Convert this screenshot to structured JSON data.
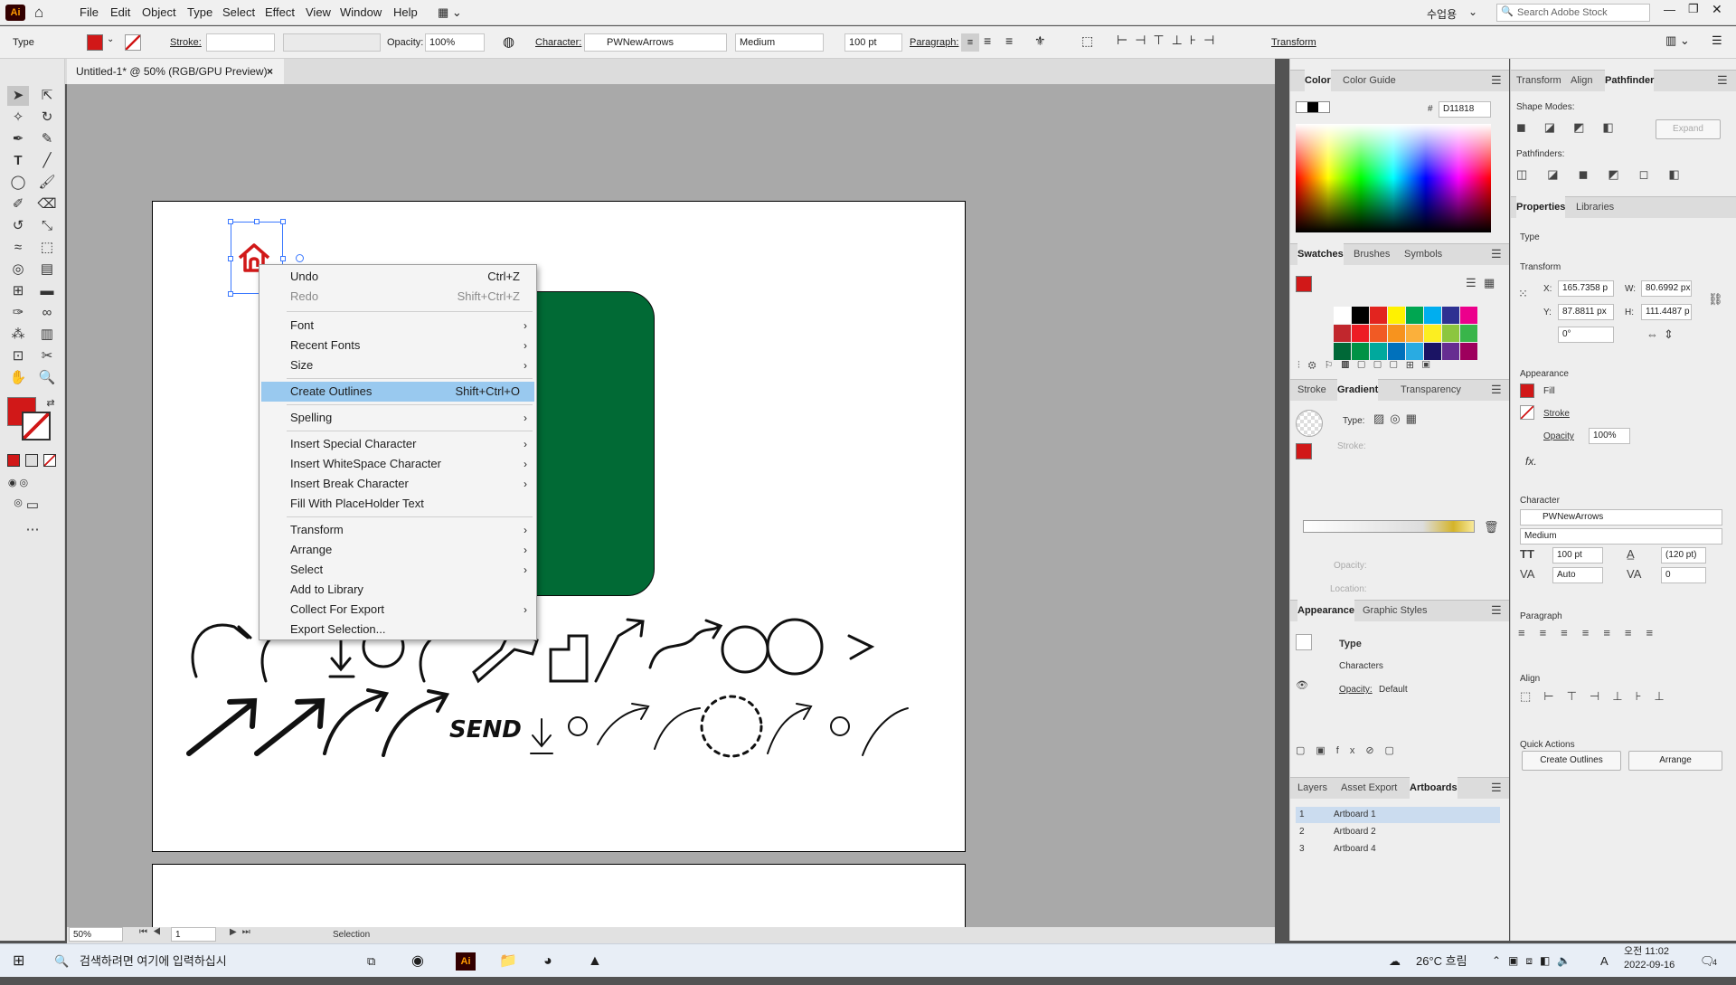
{
  "app": {
    "logo": "Ai",
    "ws": "수업용",
    "stock": "Search Adobe Stock"
  },
  "menu": [
    "File",
    "Edit",
    "Object",
    "Type",
    "Select",
    "Effect",
    "View",
    "Window",
    "Help"
  ],
  "ctrl": {
    "type": "Type",
    "stroke": "Stroke:",
    "opacity_l": "Opacity:",
    "opacity": "100%",
    "char_l": "Character:",
    "font": "PWNewArrows",
    "style": "Medium",
    "size": "100 pt",
    "para_l": "Paragraph:",
    "transform": "Transform"
  },
  "doc": {
    "tab": "Untitled-1* @ 50% (RGB/GPU Preview)",
    "close": "×"
  },
  "ctx": {
    "undo": "Undo",
    "undo_k": "Ctrl+Z",
    "redo": "Redo",
    "redo_k": "Shift+Ctrl+Z",
    "font": "Font",
    "recent": "Recent Fonts",
    "size": "Size",
    "outlines": "Create Outlines",
    "outlines_k": "Shift+Ctrl+O",
    "spell": "Spelling",
    "special": "Insert Special Character",
    "ws": "Insert WhiteSpace Character",
    "brk": "Insert Break Character",
    "fill": "Fill With PlaceHolder Text",
    "transform": "Transform",
    "arrange": "Arrange",
    "select": "Select",
    "lib": "Add to Library",
    "collect": "Collect For Export",
    "export": "Export Selection...",
    "arrow": "›"
  },
  "art": {
    "send": "SEND"
  },
  "color": {
    "tab1": "Color",
    "tab2": "Color Guide",
    "hex": "D11818",
    "hash": "#"
  },
  "sw": {
    "tab1": "Swatches",
    "tab2": "Brushes",
    "tab3": "Symbols",
    "row1": [
      "#ffffff",
      "#000000",
      "#e2241f",
      "#fff200",
      "#00a651",
      "#00aeef",
      "#2e3192",
      "#ec008c"
    ],
    "row2": [
      "#c1272d",
      "#ed1c24",
      "#f15a24",
      "#f7931e",
      "#fbb03b",
      "#fcee21",
      "#8cc63f",
      "#39b54a"
    ],
    "row3": [
      "#006837",
      "#009245",
      "#00a99d",
      "#0071bc",
      "#29abe2",
      "#1b1464",
      "#662d91",
      "#9e005d"
    ]
  },
  "grad": {
    "tab1": "Stroke",
    "tab2": "Gradient",
    "tab3": "Transparency",
    "type": "Type:",
    "stroke": "Stroke:",
    "opacity": "Opacity:",
    "location": "Location:"
  },
  "appear": {
    "tab1": "Appearance",
    "tab2": "Graphic Styles",
    "type": "Type",
    "chars": "Characters",
    "op": "Opacity:",
    "def": "Default"
  },
  "layers": {
    "tab1": "Layers",
    "tab2": "Asset Export",
    "tab3": "Artboards",
    "rows": [
      {
        "n": "1",
        "name": "Artboard 1"
      },
      {
        "n": "2",
        "name": "Artboard 2"
      },
      {
        "n": "3",
        "name": "Artboard 4"
      }
    ]
  },
  "rp2": {
    "tab1": "Transform",
    "tab2": "Align",
    "tab3": "Pathfinder",
    "shape": "Shape Modes:",
    "pf": "Pathfinders:",
    "expand": "Expand",
    "ptab1": "Properties",
    "ptab2": "Libraries",
    "type": "Type",
    "tr": "Transform",
    "x": "165.7358 p",
    "y": "87.8811 px",
    "w": "80.6992 px",
    "h": "111.4487 p",
    "ang": "0°",
    "ap": "Appearance",
    "fill": "Fill",
    "stroke": "Stroke",
    "opacity": "Opacity",
    "opv": "100%",
    "fx": "fx.",
    "ch": "Character",
    "font": "PWNewArrows",
    "style": "Medium",
    "size": "100 pt",
    "lead": "(120 pt)",
    "kern": "Auto",
    "track": "0",
    "para": "Paragraph",
    "align": "Align",
    "qa": "Quick Actions",
    "b1": "Create Outlines",
    "b2": "Arrange"
  },
  "status": {
    "zoom": "50%",
    "page": "1",
    "mode": "Selection"
  },
  "taskbar": {
    "search": "검색하려면 여기에 입력하십시",
    "temp": "26°C 흐림",
    "ime": "A",
    "time": "오전 11:02",
    "date": "2022-09-16",
    "badge": "4"
  }
}
